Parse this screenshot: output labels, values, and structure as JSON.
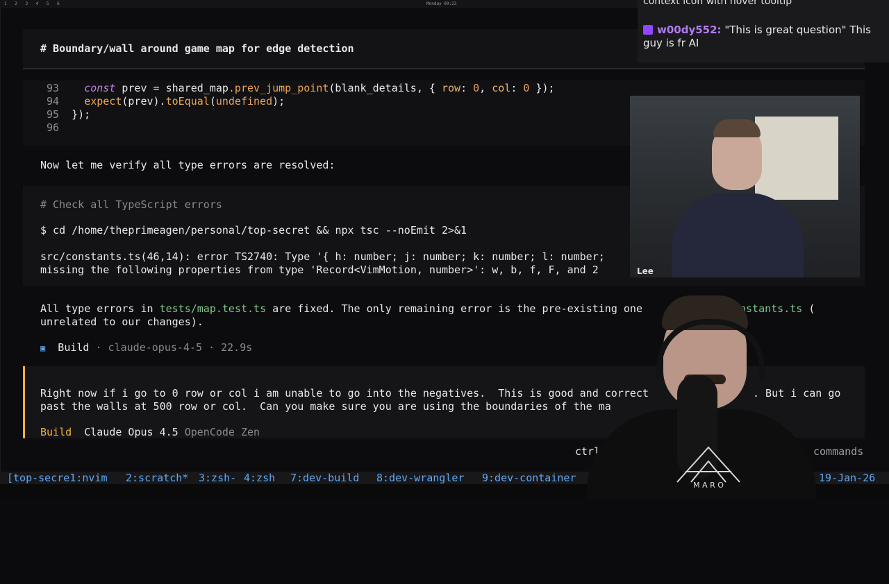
{
  "topbar": {
    "workspaces": "1 2 3 4 5 6",
    "clock": "Monday 09:23"
  },
  "block1": {
    "comment": "# Boundary/wall around game map for edge detection"
  },
  "code": {
    "lines": [
      {
        "num": "93",
        "kw": "const",
        "text1": " prev = ",
        "obj": "shared_map",
        "fn": ".prev_jump_point",
        "text2": "(blank_details, { ",
        "k1": "row",
        "c1": ": ",
        "v1": "0",
        "c2": ", ",
        "k2": "col",
        "c3": ": ",
        "v2": "0",
        "end": " });"
      },
      {
        "num": "94",
        "fn1": "expect",
        "t1": "(prev).",
        "fn2": "toEqual",
        "t2": "(",
        "undef": "undefined",
        "t3": ");"
      },
      {
        "num": "95",
        "text": "});"
      },
      {
        "num": "96",
        "text": ""
      }
    ]
  },
  "verify_text": "Now let me verify all type errors are resolved:",
  "check": {
    "comment": "# Check all TypeScript errors",
    "command": "$ cd /home/theprimeagen/personal/top-secret && npx tsc --noEmit 2>&1",
    "error1": "src/constants.ts(46,14): error TS2740: Type '{ h: number; j: number; k: number; l: number;",
    "error2": "missing the following properties from type 'Record<VimMotion, number>': w, b, f, F, and 2"
  },
  "summary": {
    "part1": "All type errors in ",
    "file1": "tests/map.test.ts",
    "part2": " are fixed. The only remaining error is the pre-existing one",
    "file2": "nstants.ts",
    "part3": " (",
    "line2": "unrelated to our changes)."
  },
  "build_status": {
    "icon": "▣",
    "label": "Build",
    "sep": " · ",
    "model": "claude-opus-4-5",
    "time": "22.9s"
  },
  "prompt": {
    "line1": "Right now if i go to 0 row or col i am unable to go into the negatives.  This is good and correct",
    "line1b": ". But i can go",
    "line2": "past the walls at 500 row or col.  Can you make sure you are using the boundaries of the ma",
    "mode": "Build",
    "model": "Claude Opus 4.5",
    "provider": "OpenCode Zen"
  },
  "hints": {
    "ctrl": "ctrl",
    "commands": "commands"
  },
  "statusbar": {
    "session": "[top-secre1:nvim",
    "win2": "2:scratch*",
    "win3": "3:zsh-",
    "win4": "4:zsh",
    "win7": "7:dev-build",
    "win8": "8:dev-wrangler",
    "win9": "9:dev-container",
    "date": "19-Jan-26"
  },
  "chat": {
    "previous": "context icon with hover tooltip",
    "user": "w00dy552:",
    "message": "\"This is great question\" This guy is fr AI"
  },
  "webcam": {
    "name_tag": "Lee",
    "shirt_letters": "M A R O"
  }
}
